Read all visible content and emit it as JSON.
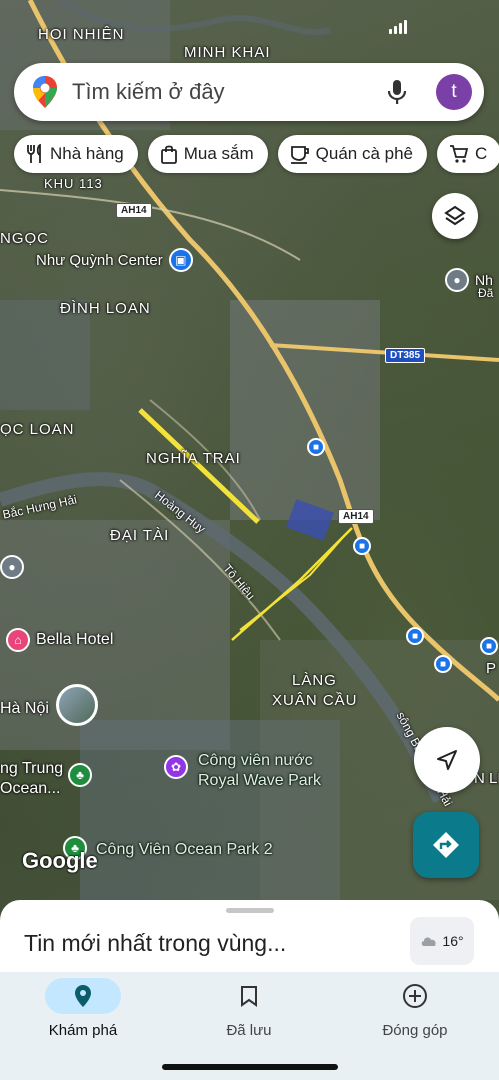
{
  "map": {
    "labels": [
      "HOI NHIÊN",
      "MINH KHAI",
      "KHU 113",
      "NGỌC",
      "ĐÌNH LOAN",
      "ỌC LOAN",
      "NGHĨA TRAI",
      "ĐẠI TÀI",
      "LÀNG",
      "XUÂN CẦU"
    ],
    "roads": [
      "Bắc Hưng Hải",
      "Hoàng Huy",
      "Tô Hiệu",
      "sông Bắc Hưng Hải"
    ],
    "road_badges": [
      "AH14",
      "DT385",
      "AH14"
    ],
    "pois": [
      {
        "name": "Như Quỳnh Center",
        "icon": "shopping-icon",
        "color": "#1a73e8"
      },
      {
        "name": "Nh",
        "icon": "place-icon",
        "color": "#6f7c85"
      },
      {
        "name": "Bella Hotel",
        "icon": "hotel-icon",
        "color": "#e8457a"
      },
      {
        "name": "Hà Nội",
        "icon": "photo-thumbnail",
        "color": "#ffffff"
      },
      {
        "name": "ng Trung",
        "icon": "park-icon",
        "color": "#1e8e3e"
      },
      {
        "name": "Ocean...",
        "icon": "park-icon",
        "color": "#1e8e3e"
      },
      {
        "name": "Công viên nước",
        "icon": "attraction-icon",
        "color": "#9334e6"
      },
      {
        "name": "Royal Wave Park",
        "icon": "attraction-icon",
        "color": "#9334e6"
      },
      {
        "name": "Công Viên Ocean Park 2",
        "icon": "park-icon",
        "color": "#1e8e3e"
      },
      {
        "name": "N LI",
        "icon": "",
        "color": "#ffffff"
      },
      {
        "name": "P",
        "icon": "",
        "color": "#ffffff"
      },
      {
        "name": "Đã",
        "icon": "",
        "color": "#ffffff"
      }
    ],
    "google_logo": "Google"
  },
  "search": {
    "placeholder": "Tìm kiếm ở đây",
    "avatar_letter": "t"
  },
  "chips": [
    {
      "label": "Nhà hàng",
      "icon": "restaurant-icon"
    },
    {
      "label": "Mua sắm",
      "icon": "shopping-bag-icon"
    },
    {
      "label": "Quán cà phê",
      "icon": "coffee-icon"
    },
    {
      "label": "C",
      "icon": "cart-icon"
    }
  ],
  "sheet": {
    "title": "Tin mới nhất trong vùng...",
    "temperature": "16°"
  },
  "nav": [
    {
      "label": "Khám phá",
      "icon": "explore-pin-icon",
      "active": true
    },
    {
      "label": "Đã lưu",
      "icon": "bookmark-icon",
      "active": false
    },
    {
      "label": "Đóng góp",
      "icon": "add-circle-icon",
      "active": false
    }
  ],
  "colors": {
    "accent": "#0b7a8a",
    "avatar": "#7b3fa8",
    "nav_active": "#c2e7ff"
  }
}
